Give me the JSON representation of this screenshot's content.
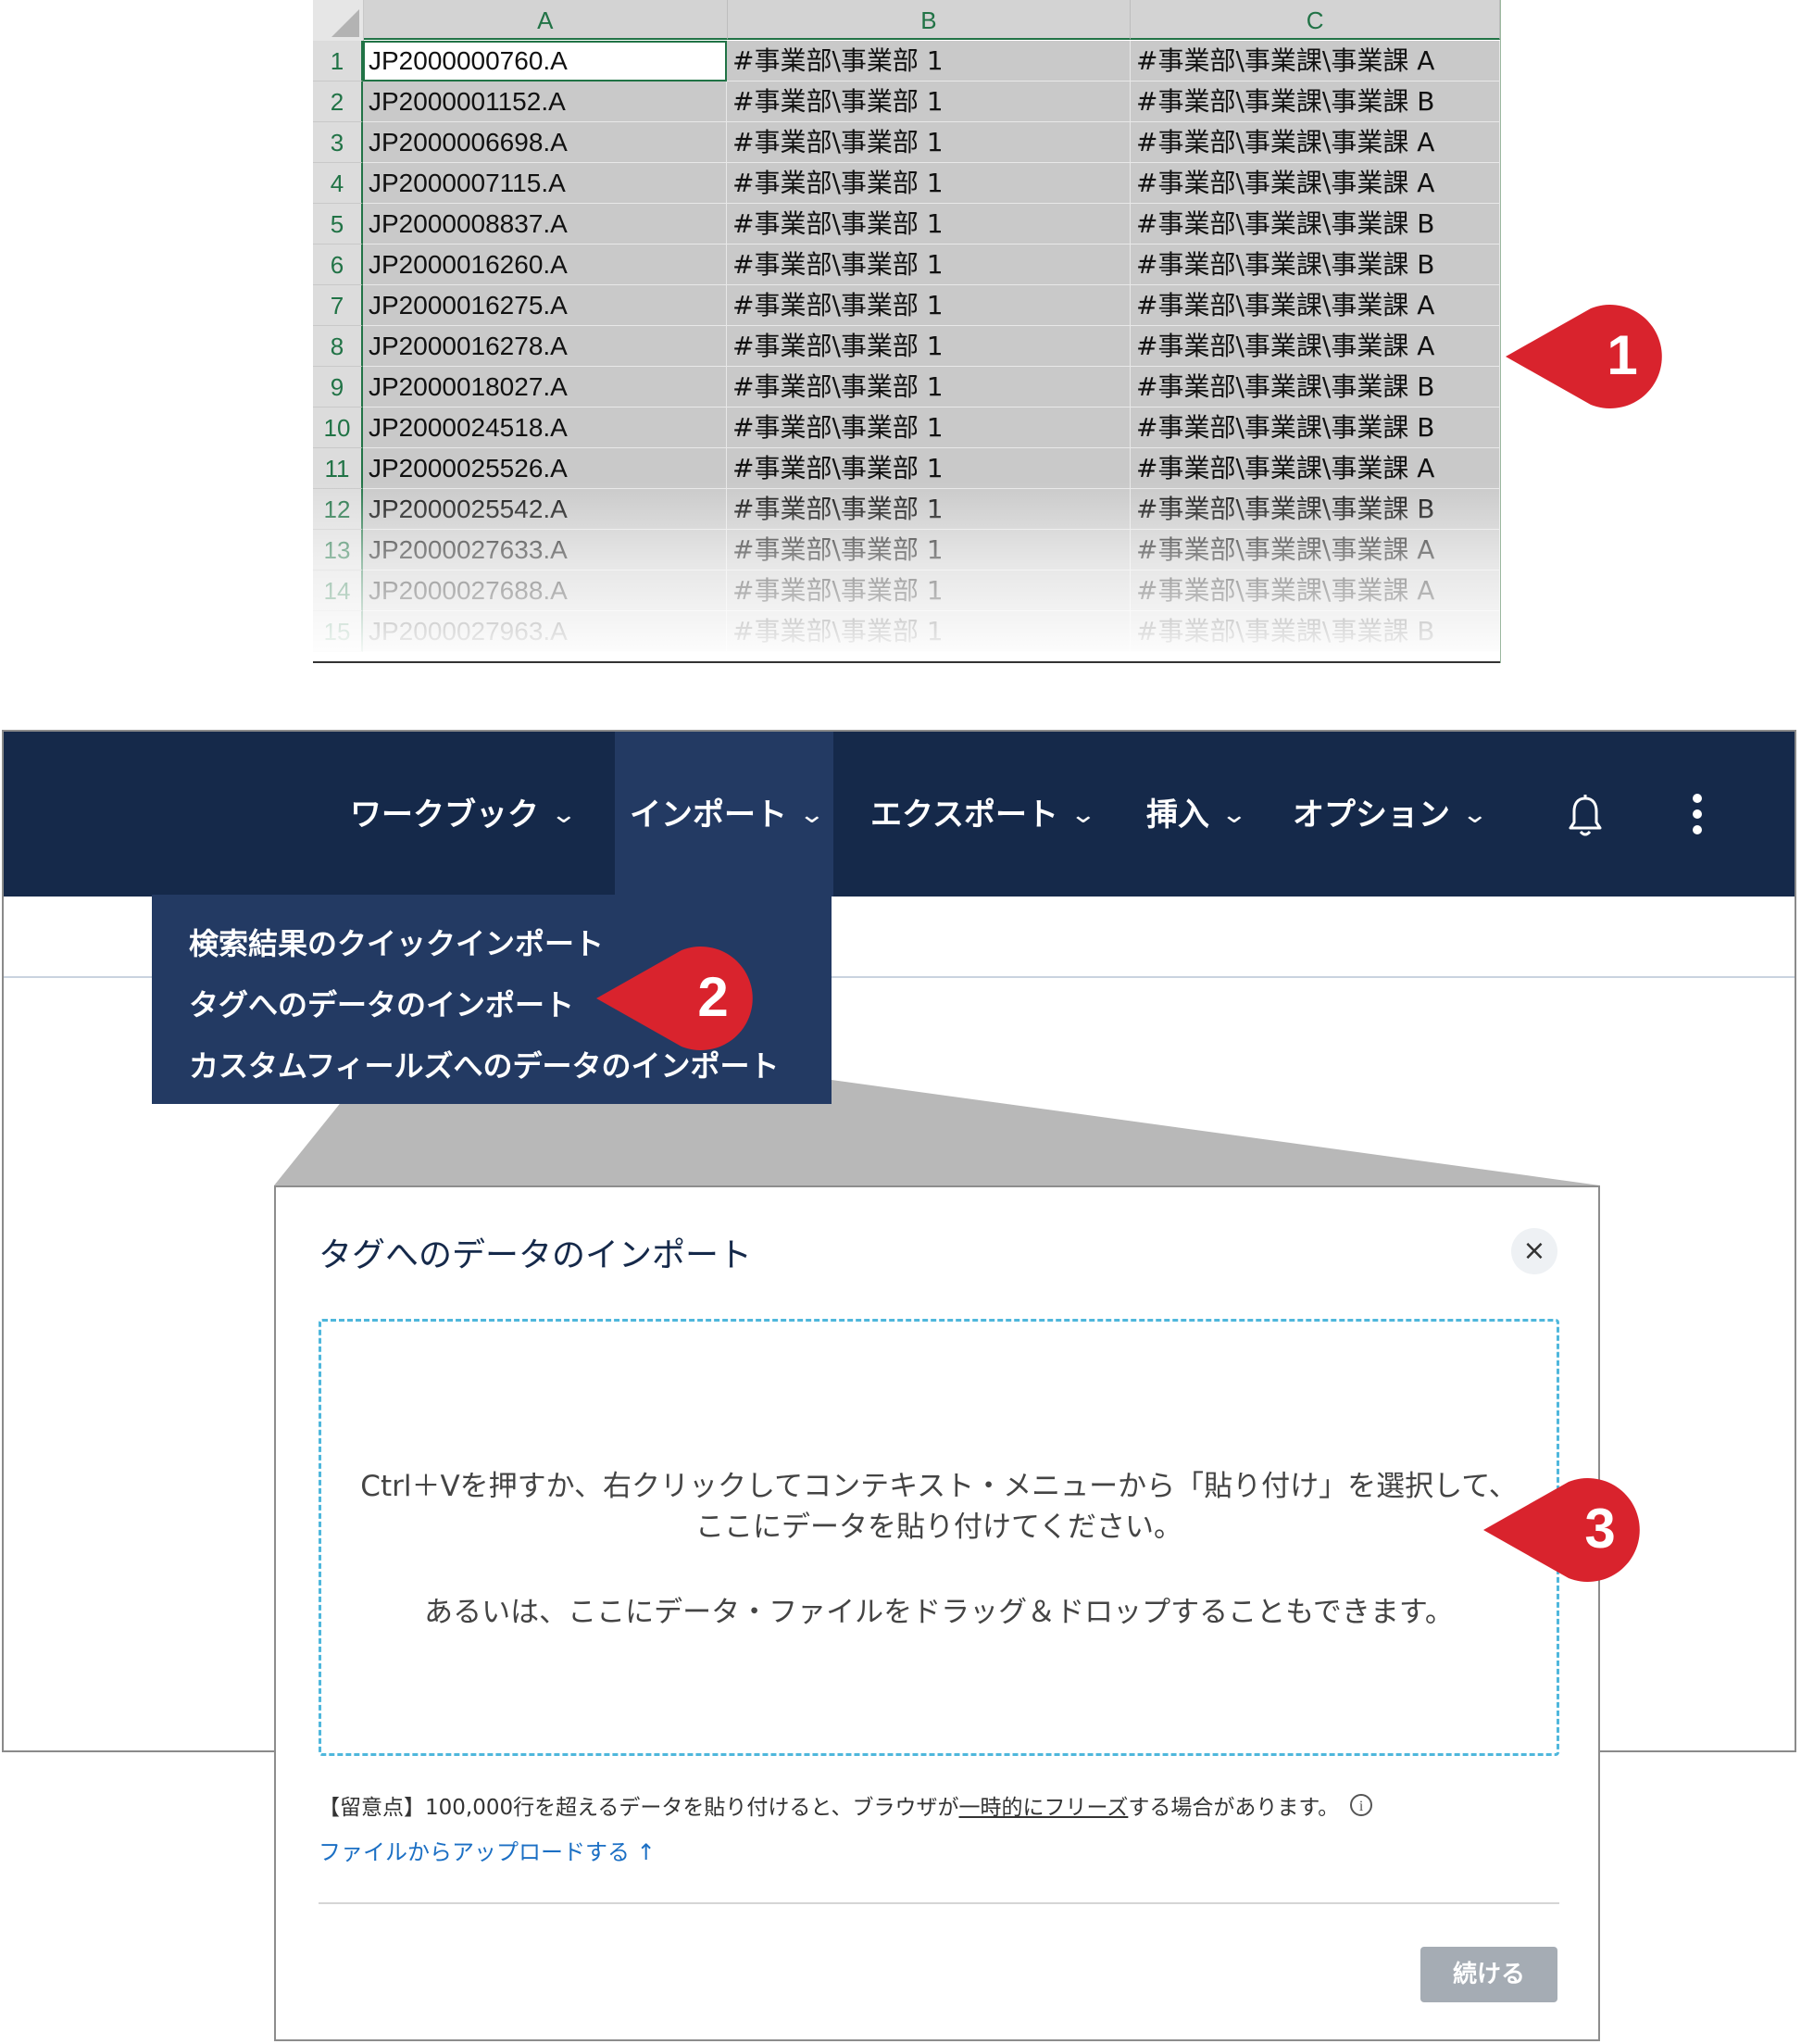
{
  "spreadsheet": {
    "columns": [
      "A",
      "B",
      "C"
    ],
    "rows": [
      {
        "n": "1",
        "a": "JP2000000760.A",
        "b": "#事業部\\事業部 1",
        "c": "#事業部\\事業課\\事業課 A"
      },
      {
        "n": "2",
        "a": "JP2000001152.A",
        "b": "#事業部\\事業部 1",
        "c": "#事業部\\事業課\\事業課 B"
      },
      {
        "n": "3",
        "a": "JP2000006698.A",
        "b": "#事業部\\事業部 1",
        "c": "#事業部\\事業課\\事業課 A"
      },
      {
        "n": "4",
        "a": "JP2000007115.A",
        "b": "#事業部\\事業部 1",
        "c": "#事業部\\事業課\\事業課 A"
      },
      {
        "n": "5",
        "a": "JP2000008837.A",
        "b": "#事業部\\事業部 1",
        "c": "#事業部\\事業課\\事業課 B"
      },
      {
        "n": "6",
        "a": "JP2000016260.A",
        "b": "#事業部\\事業部 1",
        "c": "#事業部\\事業課\\事業課 B"
      },
      {
        "n": "7",
        "a": "JP2000016275.A",
        "b": "#事業部\\事業部 1",
        "c": "#事業部\\事業課\\事業課 A"
      },
      {
        "n": "8",
        "a": "JP2000016278.A",
        "b": "#事業部\\事業部 1",
        "c": "#事業部\\事業課\\事業課 A"
      },
      {
        "n": "9",
        "a": "JP2000018027.A",
        "b": "#事業部\\事業部 1",
        "c": "#事業部\\事業課\\事業課 B"
      },
      {
        "n": "10",
        "a": "JP2000024518.A",
        "b": "#事業部\\事業部 1",
        "c": "#事業部\\事業課\\事業課 B"
      },
      {
        "n": "11",
        "a": "JP2000025526.A",
        "b": "#事業部\\事業部 1",
        "c": "#事業部\\事業課\\事業課 A"
      },
      {
        "n": "12",
        "a": "JP2000025542.A",
        "b": "#事業部\\事業部 1",
        "c": "#事業部\\事業課\\事業課 B"
      },
      {
        "n": "13",
        "a": "JP2000027633.A",
        "b": "#事業部\\事業部 1",
        "c": "#事業部\\事業課\\事業課 A"
      },
      {
        "n": "14",
        "a": "JP2000027688.A",
        "b": "#事業部\\事業部 1",
        "c": "#事業部\\事業課\\事業課 A"
      },
      {
        "n": "15",
        "a": "JP2000027963.A",
        "b": "#事業部\\事業部 1",
        "c": "#事業部\\事業課\\事業課 B"
      }
    ]
  },
  "callouts": {
    "c1": "1",
    "c2": "2",
    "c3": "3"
  },
  "navbar": {
    "items": [
      "ワークブック",
      "インポート",
      "エクスポート",
      "挿入",
      "オプション"
    ],
    "chevron": "⌄",
    "icons": [
      "bell-icon",
      "kebab-menu-icon"
    ]
  },
  "dropdown": {
    "items": [
      "検索結果のクイックインポート",
      "タグへのデータのインポート",
      "カスタムフィールズへのデータのインポート"
    ]
  },
  "dialog": {
    "title": "タグへのデータのインポート",
    "close": "×",
    "dropzone_line1": "Ctrl＋Vを押すか、右クリックしてコンテキスト・メニューから「貼り付け」を選択して、ここにデータを貼り付けてください。",
    "dropzone_line2": "あるいは、ここにデータ・ファイルをドラッグ＆ドロップすることもできます。",
    "note_before": "【留意点】100,000行を超えるデータを貼り付けると、ブラウザが",
    "note_link": "一時的にフリーズ",
    "note_after": "する場合があります。",
    "info": "i",
    "upload_link": "ファイルからアップロードする ↑",
    "continue_button": "続ける"
  },
  "colors": {
    "navbar_bg": "#15294a",
    "navbar_active": "#233a63",
    "callout_red": "#d9232d",
    "excel_green": "#217346",
    "dropzone_border": "#4fb7dc",
    "link_blue": "#1b6fc4",
    "button_disabled": "#a5acb4"
  }
}
